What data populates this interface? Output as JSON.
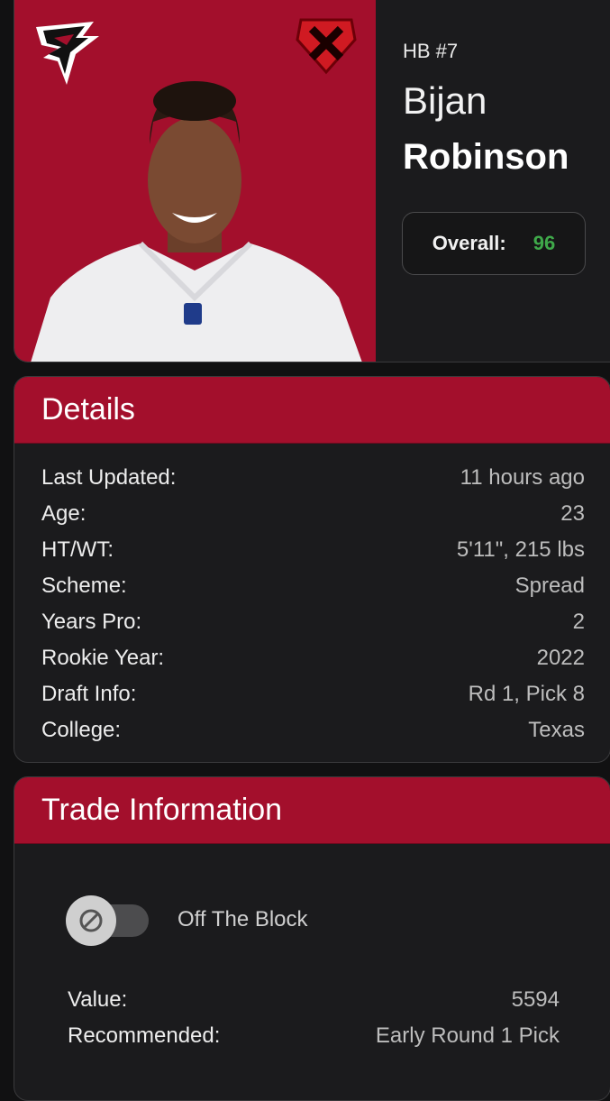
{
  "player": {
    "position": "HB #7",
    "first_name": "Bijan",
    "last_name": "Robinson",
    "overall_label": "Overall:",
    "overall_value": "96"
  },
  "colors": {
    "team_red": "#a30f2c",
    "overall_green": "#3fa94a"
  },
  "icons": {
    "team_logo": "falcons-logo",
    "app_logo": "red-x-logo"
  },
  "details": {
    "title": "Details",
    "rows": [
      {
        "label": "Last Updated:",
        "value": "11 hours ago"
      },
      {
        "label": "Age:",
        "value": "23"
      },
      {
        "label": "HT/WT:",
        "value": "5'11\", 215 lbs"
      },
      {
        "label": "Scheme:",
        "value": "Spread"
      },
      {
        "label": "Years Pro:",
        "value": "2"
      },
      {
        "label": "Rookie Year:",
        "value": "2022"
      },
      {
        "label": "Draft Info:",
        "value": "Rd 1, Pick 8"
      },
      {
        "label": "College:",
        "value": "Texas"
      }
    ]
  },
  "trade": {
    "title": "Trade Information",
    "toggle_label": "Off The Block",
    "toggle_on": false,
    "rows": [
      {
        "label": "Value:",
        "value": "5594"
      },
      {
        "label": "Recommended:",
        "value": "Early Round 1 Pick"
      }
    ]
  }
}
